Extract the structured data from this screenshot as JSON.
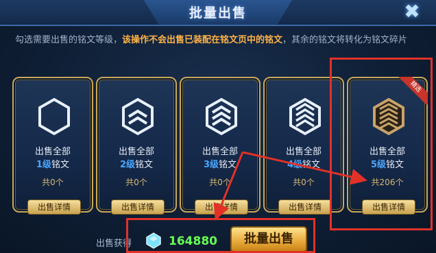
{
  "dialog": {
    "title": "批量出售",
    "close_icon": "close-icon",
    "description_plain_1": "勾选需要出售的铭文等级，",
    "description_warning": "该操作不会出售已装配在铭文页中的铭文",
    "description_plain_2": "，其余的铭文将转化为铭文碎片"
  },
  "cards": [
    {
      "line1": "出售全部",
      "level": "1级",
      "suffix": "铭文",
      "count": "共0个",
      "detail": "出售详情"
    },
    {
      "line1": "出售全部",
      "level": "2级",
      "suffix": "铭文",
      "count": "共0个",
      "detail": "出售详情"
    },
    {
      "line1": "出售全部",
      "level": "3级",
      "suffix": "铭文",
      "count": "共0个",
      "detail": "出售详情"
    },
    {
      "line1": "出售全部",
      "level": "4级",
      "suffix": "铭文",
      "count": "共0个",
      "detail": "出售详情"
    },
    {
      "line1": "出售全部",
      "level": "5级",
      "suffix": "铭文",
      "count": "共206个",
      "detail": "出售详情",
      "badge": "精选"
    }
  ],
  "footer": {
    "earn_label": "出售获得",
    "gem_icon": "crystal-gem-icon",
    "total": "164880",
    "sell_button": "批量出售"
  },
  "colors": {
    "gold_border": "#c9a85a",
    "level_blue": "#49a8ff",
    "total_green": "#66ff55",
    "annotation_red": "#e23228"
  }
}
